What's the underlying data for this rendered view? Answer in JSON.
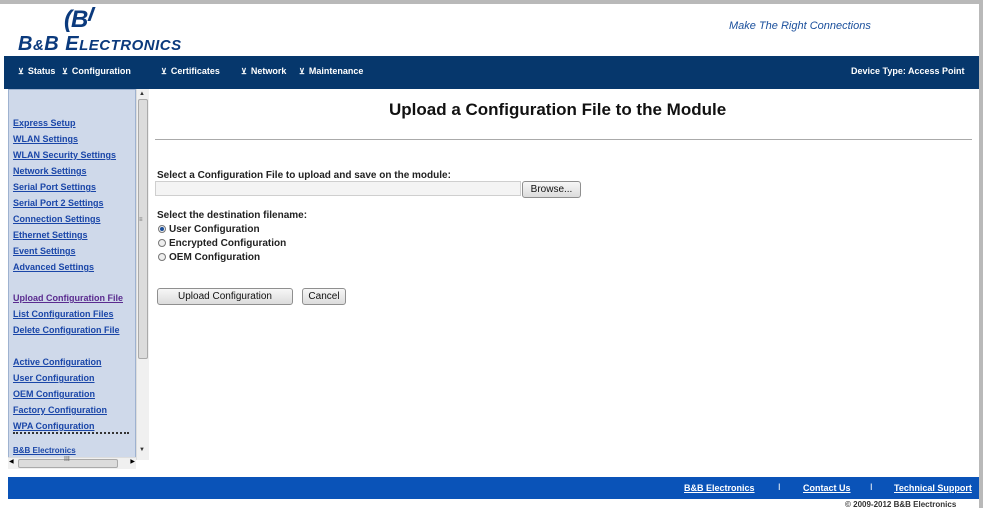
{
  "header": {
    "logo_mark": "B",
    "logo_text_big1": "B",
    "logo_amp": "&",
    "logo_text_big2": "B E",
    "logo_text_small": "LECTRONICS",
    "tagline": "Make The Right Connections"
  },
  "nav": {
    "items": [
      {
        "label": "Status"
      },
      {
        "label": "Configuration"
      },
      {
        "label": "Certificates"
      },
      {
        "label": "Network"
      },
      {
        "label": "Maintenance"
      }
    ],
    "arrow": "⊻",
    "device_type": "Device Type: Access Point"
  },
  "sidebar": {
    "items": [
      {
        "label": "Express Setup"
      },
      {
        "label": "WLAN Settings"
      },
      {
        "label": "WLAN Security Settings"
      },
      {
        "label": "Network Settings"
      },
      {
        "label": "Serial Port Settings"
      },
      {
        "label": "Serial Port 2 Settings"
      },
      {
        "label": "Connection Settings"
      },
      {
        "label": "Ethernet Settings"
      },
      {
        "label": "Event Settings"
      },
      {
        "label": "Advanced Settings"
      },
      {
        "label": "Upload Configuration File"
      },
      {
        "label": "List Configuration Files"
      },
      {
        "label": "Delete Configuration File"
      },
      {
        "label": "Active Configuration"
      },
      {
        "label": "User Configuration"
      },
      {
        "label": "OEM Configuration"
      },
      {
        "label": "Factory Configuration"
      },
      {
        "label": "WPA Configuration"
      }
    ],
    "bottom_link": "B&B Electronics",
    "scroll_grip": "≡",
    "hscroll_grip": "III"
  },
  "main": {
    "title": "Upload a Configuration File to the Module",
    "select_file_label": "Select a Configuration File to upload and save on the module:",
    "file_value": "",
    "browse_label": "Browse...",
    "dest_label": "Select the destination filename:",
    "options": [
      {
        "label": "User Configuration",
        "checked": true
      },
      {
        "label": "Encrypted Configuration",
        "checked": false
      },
      {
        "label": "OEM Configuration",
        "checked": false
      }
    ],
    "upload_label": "Upload Configuration",
    "cancel_label": "Cancel"
  },
  "footer": {
    "links": [
      {
        "label": "B&B Electronics"
      },
      {
        "label": "Contact Us"
      },
      {
        "label": "Technical Support"
      }
    ],
    "separator": "I",
    "copyright": "© 2009-2012 B&B Electronics"
  },
  "colors": {
    "navbar": "#06376c",
    "footer": "#0a53b8",
    "sidebar_bg": "#cfd9ea",
    "link": "#1a46a8"
  }
}
